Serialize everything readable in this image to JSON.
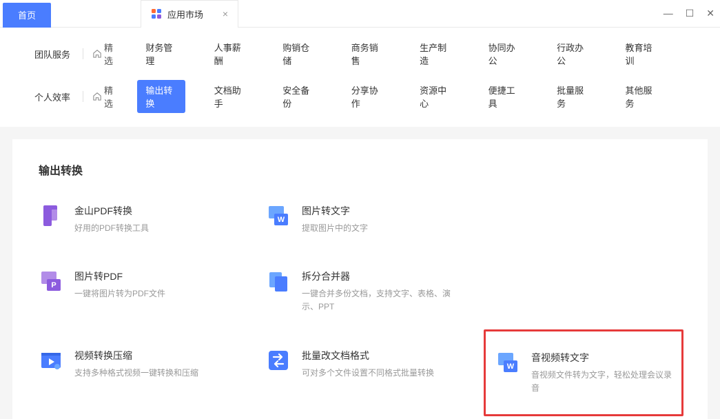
{
  "tabs": {
    "home": "首页",
    "app_market": "应用市场"
  },
  "nav": {
    "team_label": "团队服务",
    "personal_label": "个人效率",
    "featured": "精选",
    "team_items": [
      "财务管理",
      "人事薪酬",
      "购销仓储",
      "商务销售",
      "生产制造",
      "协同办公",
      "行政办公",
      "教育培训"
    ],
    "personal_items": [
      "输出转换",
      "文档助手",
      "安全备份",
      "分享协作",
      "资源中心",
      "便捷工具",
      "批量服务",
      "其他服务"
    ]
  },
  "section": {
    "title": "输出转换"
  },
  "cards": [
    {
      "title": "金山PDF转换",
      "desc": "好用的PDF转换工具"
    },
    {
      "title": "图片转文字",
      "desc": "提取图片中的文字"
    },
    {
      "title": "图片转PDF",
      "desc": "一键将图片转为PDF文件"
    },
    {
      "title": "拆分合并器",
      "desc": "一键合并多份文档，支持文字、表格、演示、PPT"
    },
    {
      "title": "视频转换压缩",
      "desc": "支持多种格式视频一键转换和压缩"
    },
    {
      "title": "批量改文档格式",
      "desc": "可对多个文件设置不同格式批量转换"
    },
    {
      "title": "音视频转文字",
      "desc": "音视频文件转为文字，轻松处理会议录音"
    }
  ]
}
